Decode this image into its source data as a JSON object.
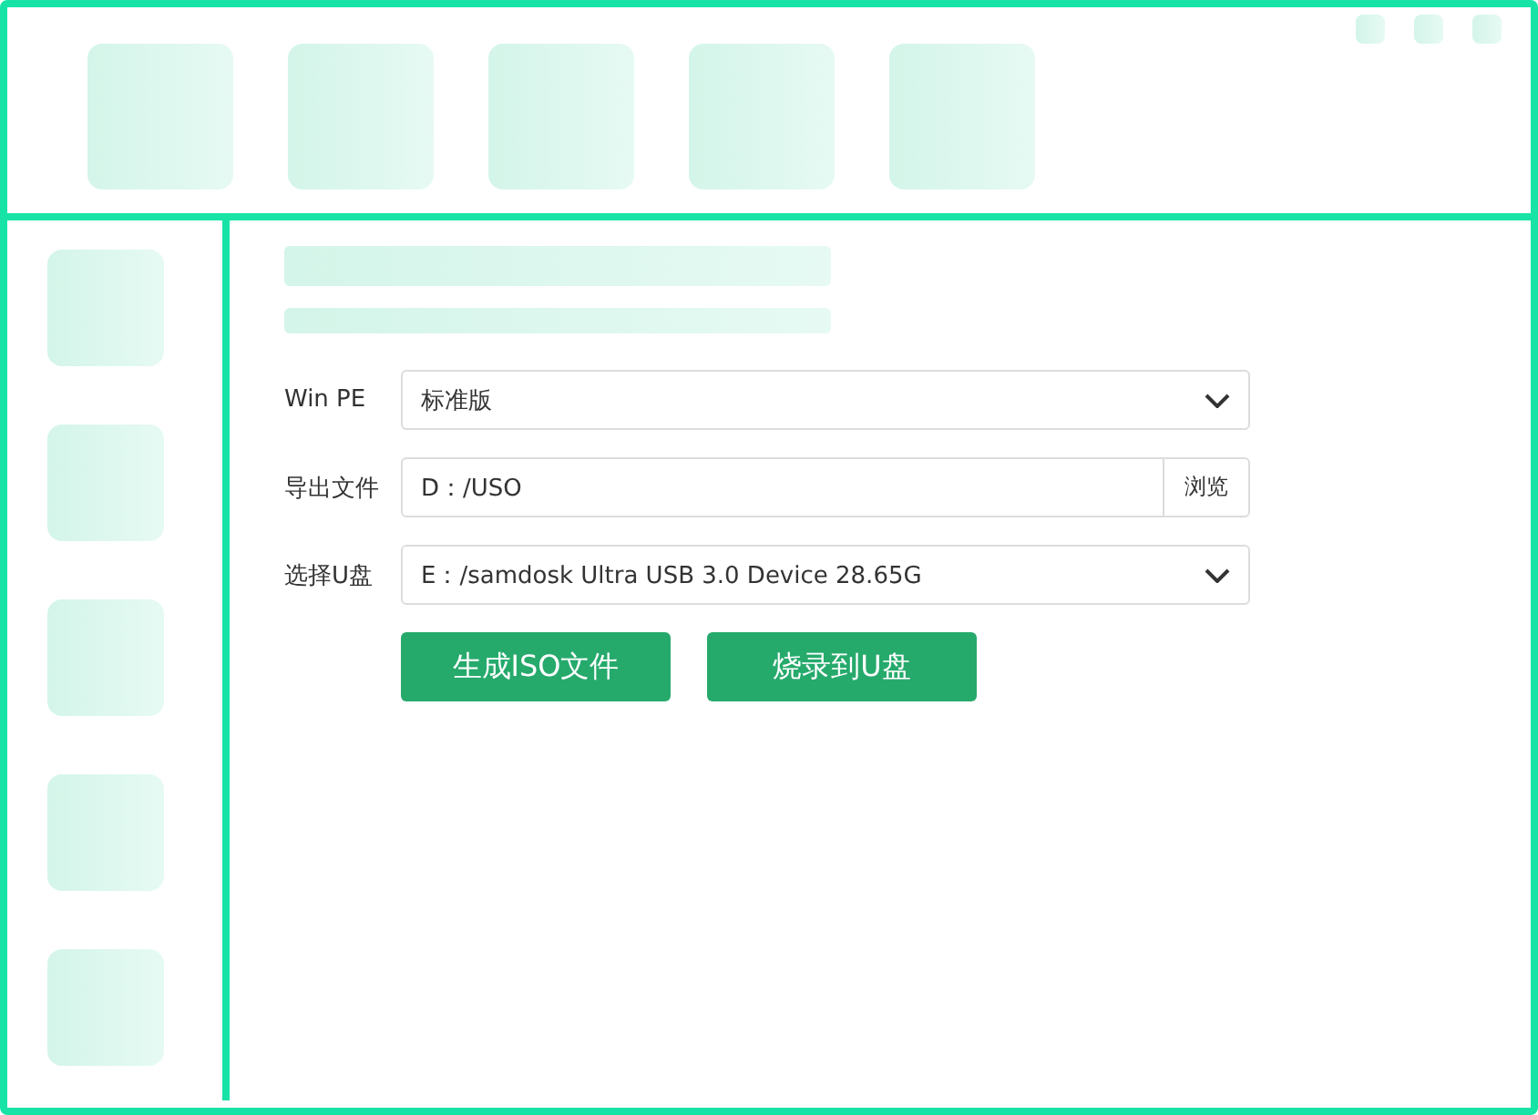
{
  "form": {
    "rows": [
      {
        "kind": "select",
        "label": "Win PE",
        "value": "标准版"
      },
      {
        "kind": "path",
        "label": "导出文件",
        "value": "D：/USO",
        "button": "浏览"
      },
      {
        "kind": "select",
        "label": "选择U盘",
        "value": "E：/samdosk Ultra USB 3.0 Device 28.65G"
      }
    ]
  },
  "buttons": [
    "生成ISO文件",
    "烧录到U盘"
  ]
}
